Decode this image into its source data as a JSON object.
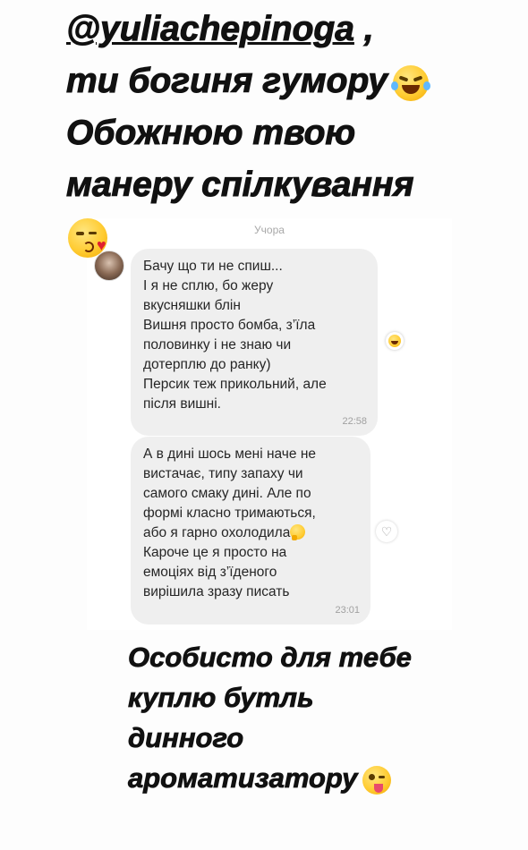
{
  "caption_top": {
    "mention": "@yuliachepinoga",
    "mention_suffix": " ,",
    "line2": "ти богиня гумору",
    "line3": "Обожнюю твою",
    "line4": "манеру спілкування"
  },
  "chat": {
    "date": "Учора",
    "messages": [
      {
        "lines": [
          "Бачу що ти не спиш...",
          "І я не сплю, бо жеру",
          "вкусняшки блін",
          "Вишня просто бомба, з’їла",
          "половинку і не знаю чи",
          "дотерплю до ранку)",
          "Персик теж прикольний, але",
          "після вишні."
        ],
        "time": "22:58"
      },
      {
        "lines": [
          "А в дині шось мені наче не",
          "вистачає, типу запаху чи",
          "самого смаку дині. Але по",
          "формі класно тримаються,",
          "або я гарно охолодила",
          "Кароче це я просто на",
          "емоціях від з’їденого",
          "вирішила зразу писать"
        ],
        "time": "23:01"
      }
    ]
  },
  "caption_bottom": {
    "line1": "Особисто для тебе",
    "line2": "куплю бутль",
    "line3": "динного",
    "line4": "ароматизатору"
  },
  "icons": {
    "laugh": "rolling-on-floor-laughing-emoji",
    "kiss": "face-blowing-kiss-emoji",
    "reaction": "grinning-face-emoji",
    "heart": "heart-outline-icon",
    "thinking": "thinking-face-emoji",
    "wink": "winking-face-tongue-emoji"
  }
}
